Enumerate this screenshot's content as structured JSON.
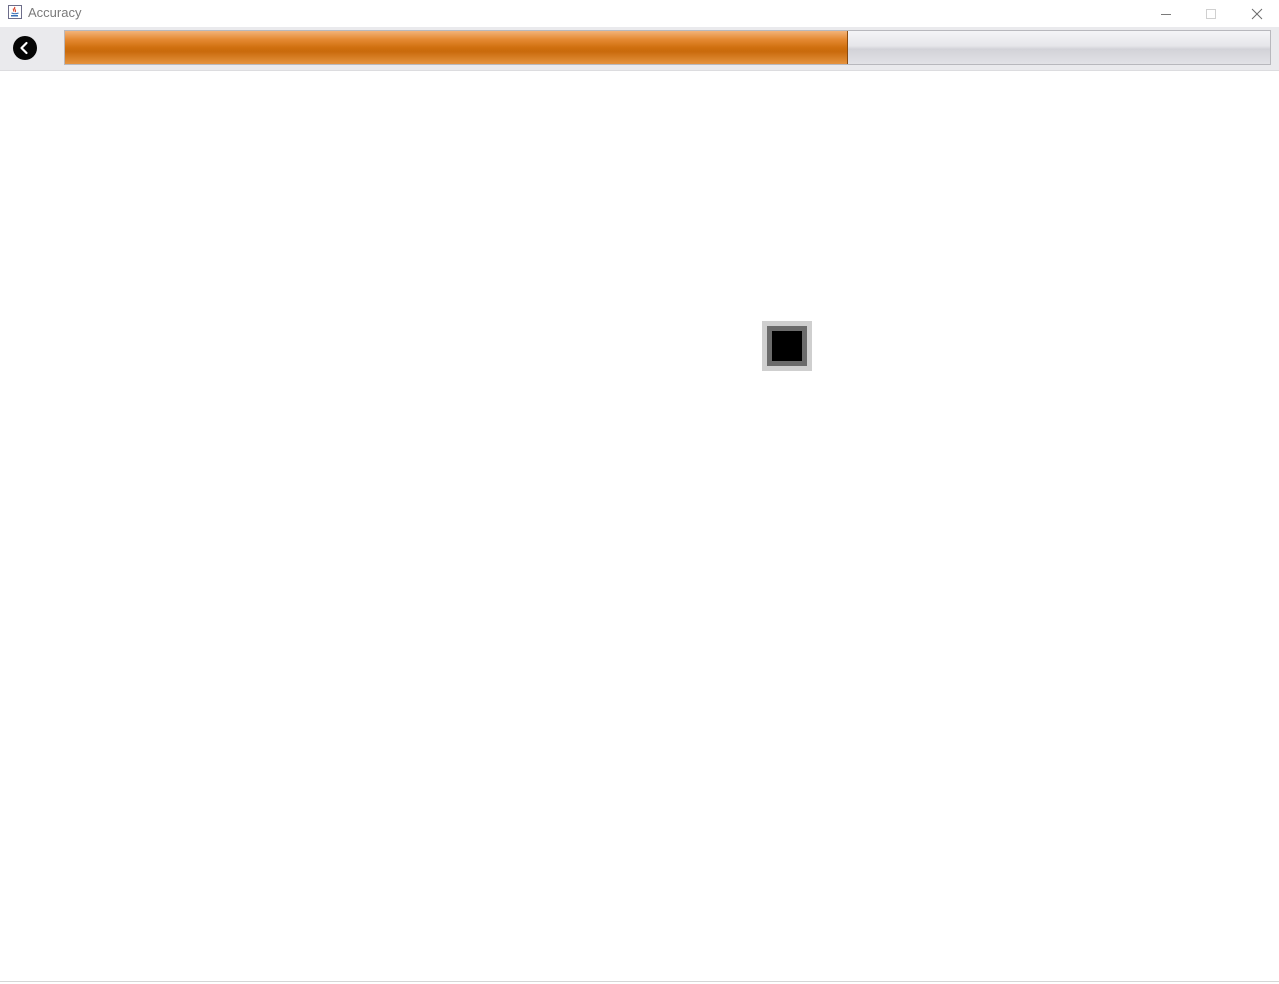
{
  "window": {
    "title": "Accuracy",
    "icons": {
      "app": "java-app-icon",
      "minimize": "minimize-icon",
      "maximize": "maximize-icon",
      "close": "close-icon"
    }
  },
  "toolbar": {
    "back_icon": "chevron-left-icon",
    "progress_fraction": 0.65,
    "colors": {
      "fill": "#d0700f",
      "track": "#e2e2e6",
      "back_button": "#050505"
    }
  },
  "canvas": {
    "target_icon": "square-target",
    "colors": {
      "outer": "#cfcfcf",
      "middle": "#6b6b6b",
      "core": "#000000"
    }
  }
}
